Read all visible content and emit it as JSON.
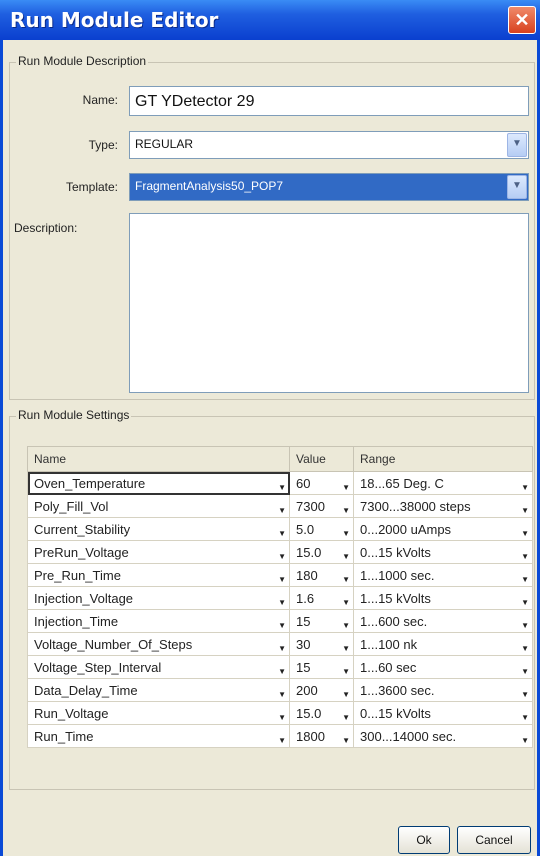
{
  "window": {
    "title": "Run Module Editor",
    "close_glyph": "✕"
  },
  "description_group": {
    "legend": "Run Module Description",
    "name_label": "Name:",
    "name_value": "GT YDetector 29",
    "type_label": "Type:",
    "type_value": "REGULAR",
    "template_label": "Template:",
    "template_value": "FragmentAnalysis50_POP7",
    "description_label": "Description:",
    "description_value": ""
  },
  "settings_group": {
    "legend": "Run Module Settings",
    "columns": [
      "Name",
      "Value",
      "Range"
    ],
    "rows": [
      {
        "name": "Oven_Temperature",
        "value": "60",
        "range": "18...65 Deg. C"
      },
      {
        "name": "Poly_Fill_Vol",
        "value": "7300",
        "range": "7300...38000 steps"
      },
      {
        "name": "Current_Stability",
        "value": "5.0",
        "range": "0...2000 uAmps"
      },
      {
        "name": "PreRun_Voltage",
        "value": "15.0",
        "range": "0...15 kVolts"
      },
      {
        "name": "Pre_Run_Time",
        "value": "180",
        "range": "1...1000 sec."
      },
      {
        "name": "Injection_Voltage",
        "value": "1.6",
        "range": "1...15 kVolts"
      },
      {
        "name": "Injection_Time",
        "value": "15",
        "range": "1...600 sec."
      },
      {
        "name": "Voltage_Number_Of_Steps",
        "value": "30",
        "range": "1...100 nk"
      },
      {
        "name": "Voltage_Step_Interval",
        "value": "15",
        "range": "1...60 sec"
      },
      {
        "name": "Data_Delay_Time",
        "value": "200",
        "range": "1...3600 sec."
      },
      {
        "name": "Run_Voltage",
        "value": "15.0",
        "range": "0...15 kVolts"
      },
      {
        "name": "Run_Time",
        "value": "1800",
        "range": "300...14000 sec."
      }
    ]
  },
  "buttons": {
    "ok": "Ok",
    "cancel": "Cancel"
  },
  "colors": {
    "titlebar": "#0a3fcf",
    "selection": "#316ac5",
    "close": "#d8411f"
  }
}
